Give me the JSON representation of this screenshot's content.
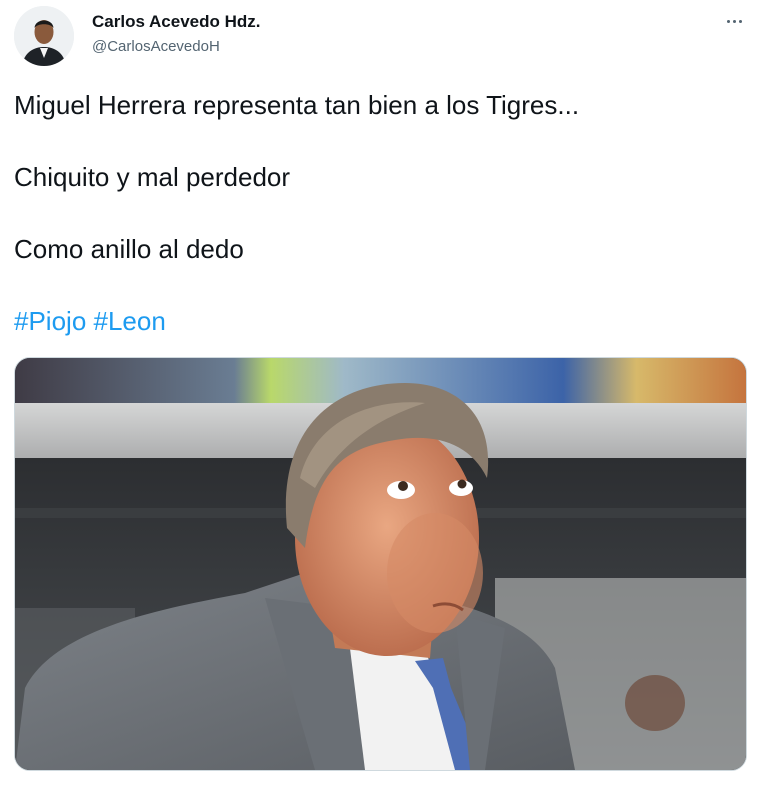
{
  "author": {
    "name": "Carlos Acevedo Hdz.",
    "handle": "@CarlosAcevedoH"
  },
  "tweet": {
    "lines": [
      "Miguel Herrera representa tan bien a los Tigres...",
      "Chiquito y mal perdedor",
      "Como anillo al dedo"
    ],
    "hashtags": [
      "#Piojo",
      "#Leon"
    ]
  },
  "icons": {
    "more": "more-horizontal-icon"
  },
  "colors": {
    "text": "#0f1419",
    "secondary": "#536471",
    "link": "#1d9bf0",
    "border": "#cfd9de"
  }
}
